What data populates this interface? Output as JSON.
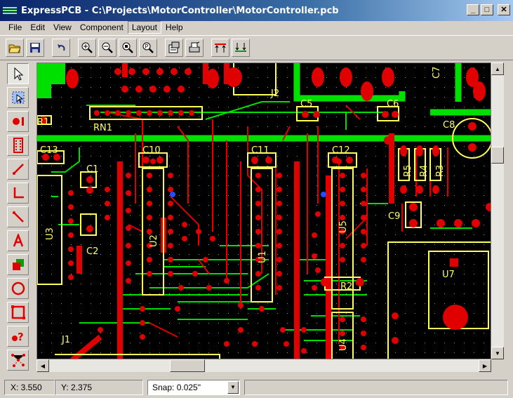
{
  "window": {
    "title": "ExpressPCB - C:\\Projects\\MotorController\\MotorController.pcb"
  },
  "window_controls": {
    "minimize": "_",
    "maximize": "□",
    "close": "✕"
  },
  "menu": [
    "File",
    "Edit",
    "View",
    "Component",
    "Layout",
    "Help"
  ],
  "toolbar": {
    "buttons": [
      "open-icon",
      "save-icon",
      "undo-icon",
      "zoom-in-icon",
      "zoom-out-icon",
      "zoom-fit-icon",
      "zoom-previous-icon",
      "properties-icon",
      "print-icon",
      "top-layer-icon",
      "bottom-layer-icon"
    ]
  },
  "tools": [
    "select-pointer-icon",
    "select-area-icon",
    "place-pad-icon",
    "place-component-icon",
    "draw-trace-icon",
    "draw-corner-icon",
    "draw-diagonal-icon",
    "place-text-icon",
    "fill-planes-icon",
    "place-circle-icon",
    "place-rectangle-icon",
    "query-icon",
    "ratsnest-icon"
  ],
  "board_labels": {
    "j2": "J2",
    "r1": "R1",
    "rn1": "RN1",
    "c5": "C5",
    "c6": "C6",
    "c7": "C7",
    "c8": "C8",
    "c13": "C13",
    "c10": "C10",
    "c11": "C11",
    "c12": "C12",
    "c1": "C1",
    "c2": "C2",
    "c9": "C9",
    "r5": "R5",
    "r4": "R4",
    "r3": "R3",
    "r2": "R2",
    "u1": "U1",
    "u2": "U2",
    "u3": "U3",
    "u4": "U4",
    "u5": "U5",
    "u7": "U7",
    "j1": "J1"
  },
  "colors": {
    "top_trace": "#00e000",
    "bottom_trace": "#e00000",
    "silkscreen": "#ffff60",
    "via": "#2050ff",
    "board": "#000000"
  },
  "status": {
    "x": "X: 3.550",
    "y": "Y: 2.375",
    "snap_label": "Snap:",
    "snap_value": "0.025\""
  }
}
